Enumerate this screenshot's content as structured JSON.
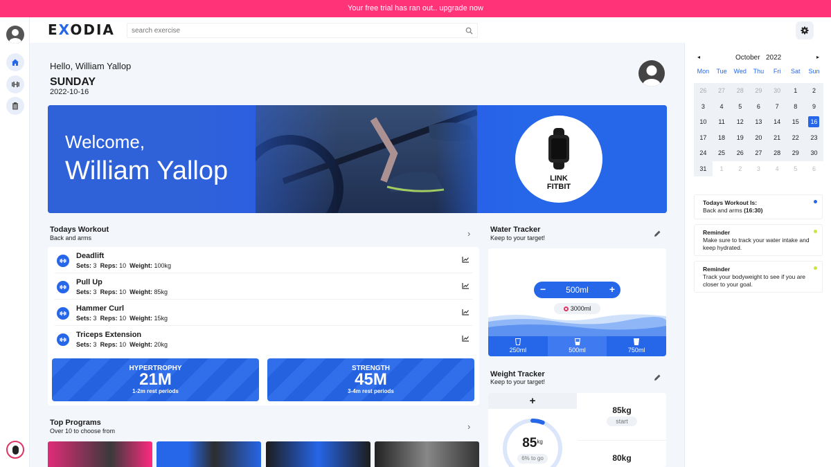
{
  "banner": {
    "text": "Your free trial has ran out.. upgrade now"
  },
  "header": {
    "logo_pre": "E",
    "logo_x": "X",
    "logo_post": "ODIA",
    "search_placeholder": "search exercise"
  },
  "greeting": {
    "hello": "Hello, William Yallop",
    "day": "SUNDAY",
    "date": "2022-10-16"
  },
  "hero": {
    "welcome": "Welcome,",
    "name": "William Yallop",
    "fitbit_line1": "LINK",
    "fitbit_line2": "FITBIT"
  },
  "workout": {
    "title": "Todays Workout",
    "subtitle": "Back and arms",
    "meta_labels": {
      "sets": "Sets:",
      "reps": "Reps:",
      "weight": "Weight:"
    },
    "exercises": [
      {
        "name": "Deadlift",
        "sets": "3",
        "reps": "10",
        "weight": "100kg"
      },
      {
        "name": "Pull Up",
        "sets": "3",
        "reps": "10",
        "weight": "85kg"
      },
      {
        "name": "Hammer Curl",
        "sets": "3",
        "reps": "10",
        "weight": "15kg"
      },
      {
        "name": "Triceps Extension",
        "sets": "3",
        "reps": "10",
        "weight": "20kg"
      }
    ],
    "stats": [
      {
        "title": "HYPERTROPHY",
        "value": "21M",
        "sub": "1-2m rest periods"
      },
      {
        "title": "STRENGTH",
        "value": "45M",
        "sub": "3-4m rest periods"
      }
    ]
  },
  "programs": {
    "title": "Top Programs",
    "subtitle": "Over 10 to choose from"
  },
  "water": {
    "title": "Water Tracker",
    "subtitle": "Keep to your target!",
    "amount": "500ml",
    "goal": "3000ml",
    "cups": [
      "250ml",
      "500ml",
      "750ml"
    ]
  },
  "weight": {
    "title": "Weight Tracker",
    "subtitle": "Keep to your target!",
    "current": "85",
    "unit": "kg",
    "to_go": "6% to go",
    "to_go_fraction": 0.06,
    "start_value": "85kg",
    "start_label": "start",
    "goal_value": "80kg"
  },
  "calendar": {
    "month": "October",
    "year": "2022",
    "dow": [
      "Mon",
      "Tue",
      "Wed",
      "Thu",
      "Fri",
      "Sat",
      "Sun"
    ],
    "weeks": [
      [
        "26",
        "27",
        "28",
        "29",
        "30",
        "1",
        "2"
      ],
      [
        "3",
        "4",
        "5",
        "6",
        "7",
        "8",
        "9"
      ],
      [
        "10",
        "11",
        "12",
        "13",
        "14",
        "15",
        "16"
      ],
      [
        "17",
        "18",
        "19",
        "20",
        "21",
        "22",
        "23"
      ],
      [
        "24",
        "25",
        "26",
        "27",
        "28",
        "29",
        "30"
      ],
      [
        "31",
        "1",
        "2",
        "3",
        "4",
        "5",
        "6"
      ]
    ],
    "today": "16"
  },
  "notes": [
    {
      "title": "Todays Workout Is:",
      "body": "Back and arms",
      "body_bold": "(16:30)",
      "dot_color": "#2666e8"
    },
    {
      "title": "Reminder",
      "body": "Make sure to track your water intake and keep hydrated.",
      "body_bold": "",
      "dot_color": "#c6e83a"
    },
    {
      "title": "Reminder",
      "body": "Track your bodyweight to see if you are closer to your goal.",
      "body_bold": "",
      "dot_color": "#c6e83a"
    }
  ],
  "colors": {
    "accent": "#2666e8",
    "banner": "#ff3377",
    "background": "#f3f6fb"
  }
}
